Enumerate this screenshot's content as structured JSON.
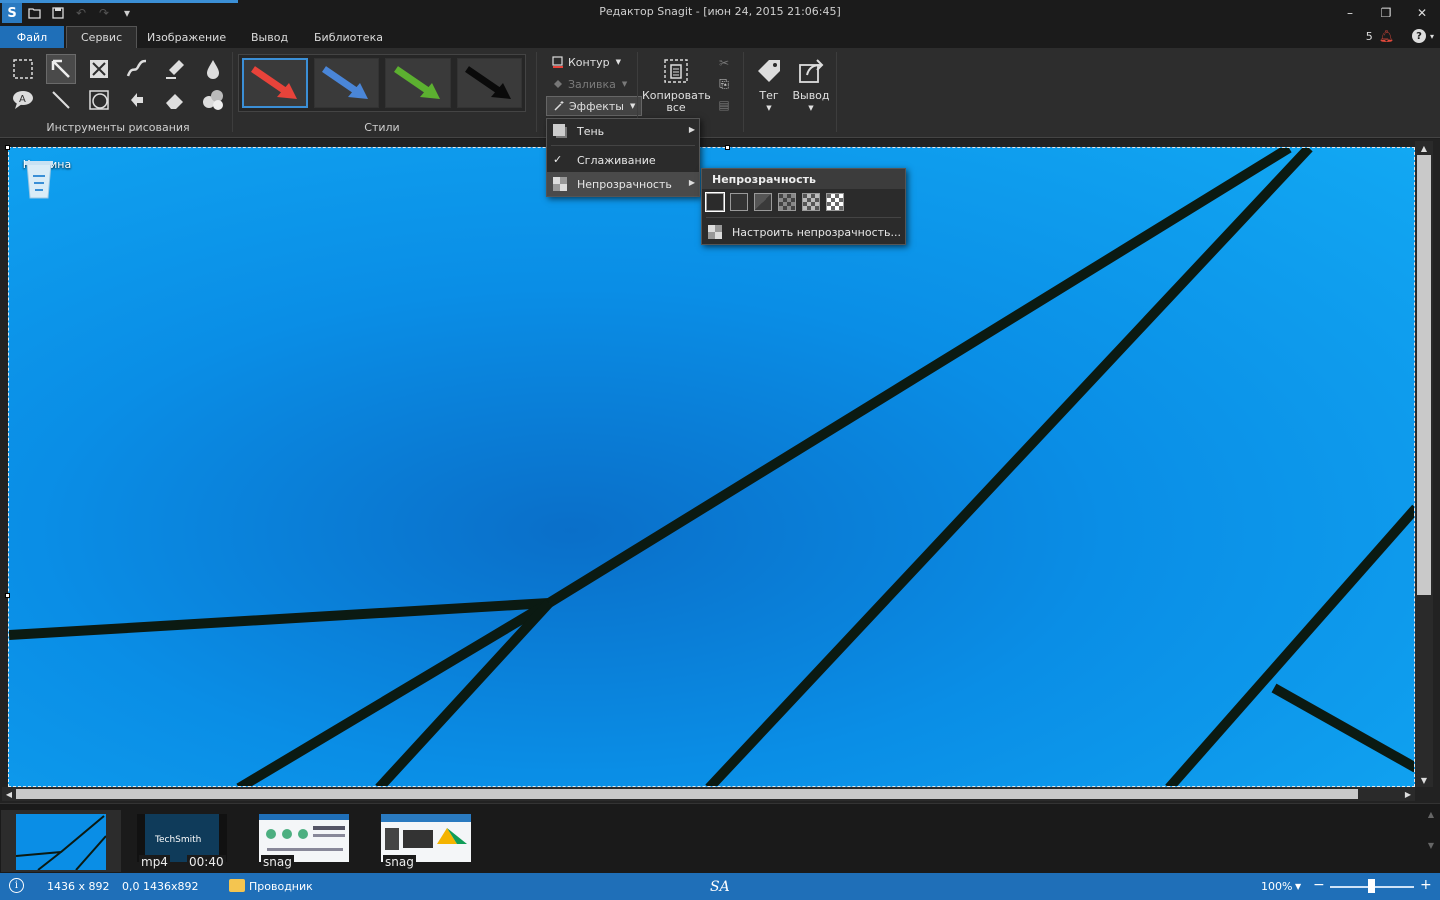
{
  "titlebar": {
    "title": "Редактор Snagit - [июн 24, 2015 21:06:45]",
    "logo": "S",
    "quick_access": [
      "open-folder-icon",
      "save-icon",
      "undo-icon",
      "redo-icon",
      "customize-icon"
    ],
    "controls": [
      "minimize",
      "restore",
      "close"
    ]
  },
  "menubar": {
    "file": "Файл",
    "tabs": [
      "Сервис",
      "Изображение",
      "Вывод",
      "Библиотека"
    ],
    "active_tab": "Сервис",
    "notifications": "5"
  },
  "ribbon": {
    "tools_label": "Инструменты рисования",
    "tools": [
      "selection",
      "arrow",
      "stamp",
      "pen",
      "highlighter",
      "fill",
      "callout",
      "line",
      "shape",
      "move",
      "eraser",
      "step"
    ],
    "styles_label": "Стили",
    "styles": [
      {
        "color": "#e8433a"
      },
      {
        "color": "#4a86d8"
      },
      {
        "color": "#5cb030"
      },
      {
        "color": "#0a0a0a"
      }
    ],
    "contour": "Контур",
    "fill": "Заливка",
    "effects": "Эффекты",
    "copy_all": "Копировать все",
    "tag": "Тег",
    "output": "Вывод"
  },
  "canvas": {
    "desktop_icon": "Корзина"
  },
  "effects_menu": {
    "items": [
      "Тень",
      "Сглаживание",
      "Непрозрачность"
    ],
    "checked": "Сглаживание",
    "highlighted": "Непрозрачность"
  },
  "opacity_menu": {
    "header": "Непрозрачность",
    "swatch_count": 6,
    "custom": "Настроить непрозрачность..."
  },
  "tray": {
    "items": [
      {
        "type": "",
        "duration": ""
      },
      {
        "type": "mp4",
        "duration": "00:40",
        "brand": "TechSmith"
      },
      {
        "type": "snag",
        "duration": ""
      },
      {
        "type": "snag",
        "duration": ""
      }
    ]
  },
  "status": {
    "dimensions": "1436 x 892",
    "cursor": "0,0  1436x892",
    "folder": "Проводник",
    "signature": "SA",
    "zoom": "100%"
  }
}
